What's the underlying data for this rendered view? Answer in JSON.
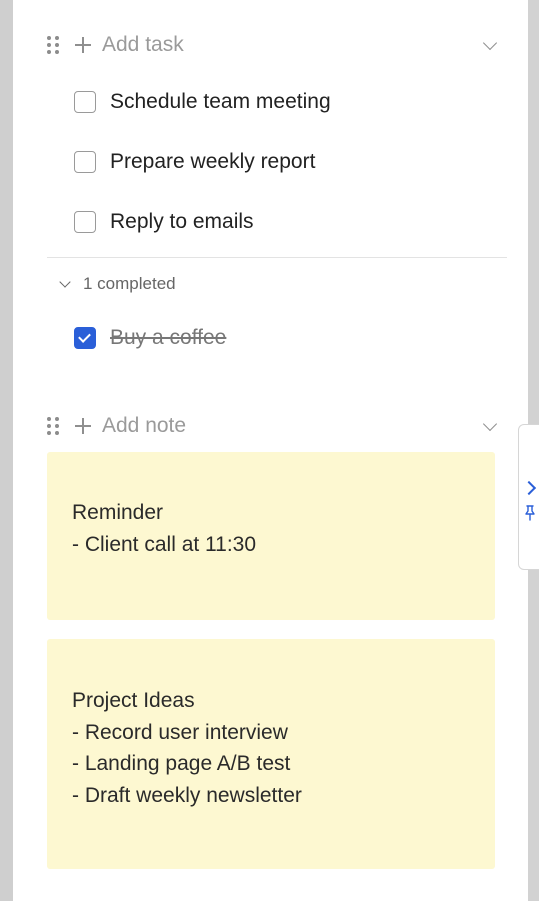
{
  "tasks": {
    "add_label": "Add task",
    "items": [
      {
        "label": "Schedule team meeting",
        "done": false
      },
      {
        "label": "Prepare weekly report",
        "done": false
      },
      {
        "label": "Reply to emails",
        "done": false
      }
    ],
    "completed_label": "1 completed",
    "completed_items": [
      {
        "label": "Buy a coffee",
        "done": true
      }
    ]
  },
  "notes": {
    "add_label": "Add note",
    "items": [
      {
        "lines": [
          "Reminder",
          "- Client call at 11:30"
        ]
      },
      {
        "lines": [
          "Project Ideas",
          "- Record user interview",
          "- Landing page A/B test",
          "- Draft weekly newsletter"
        ]
      }
    ]
  },
  "colors": {
    "accent": "#2a5fd8",
    "note_background": "#fdf8d1"
  },
  "icons": {
    "drag": "drag-handle-icon",
    "add": "plus-icon",
    "collapse": "chevron-down-icon",
    "side_tab_arrow": "chevron-right-icon",
    "side_tab_pin": "pin-icon"
  }
}
